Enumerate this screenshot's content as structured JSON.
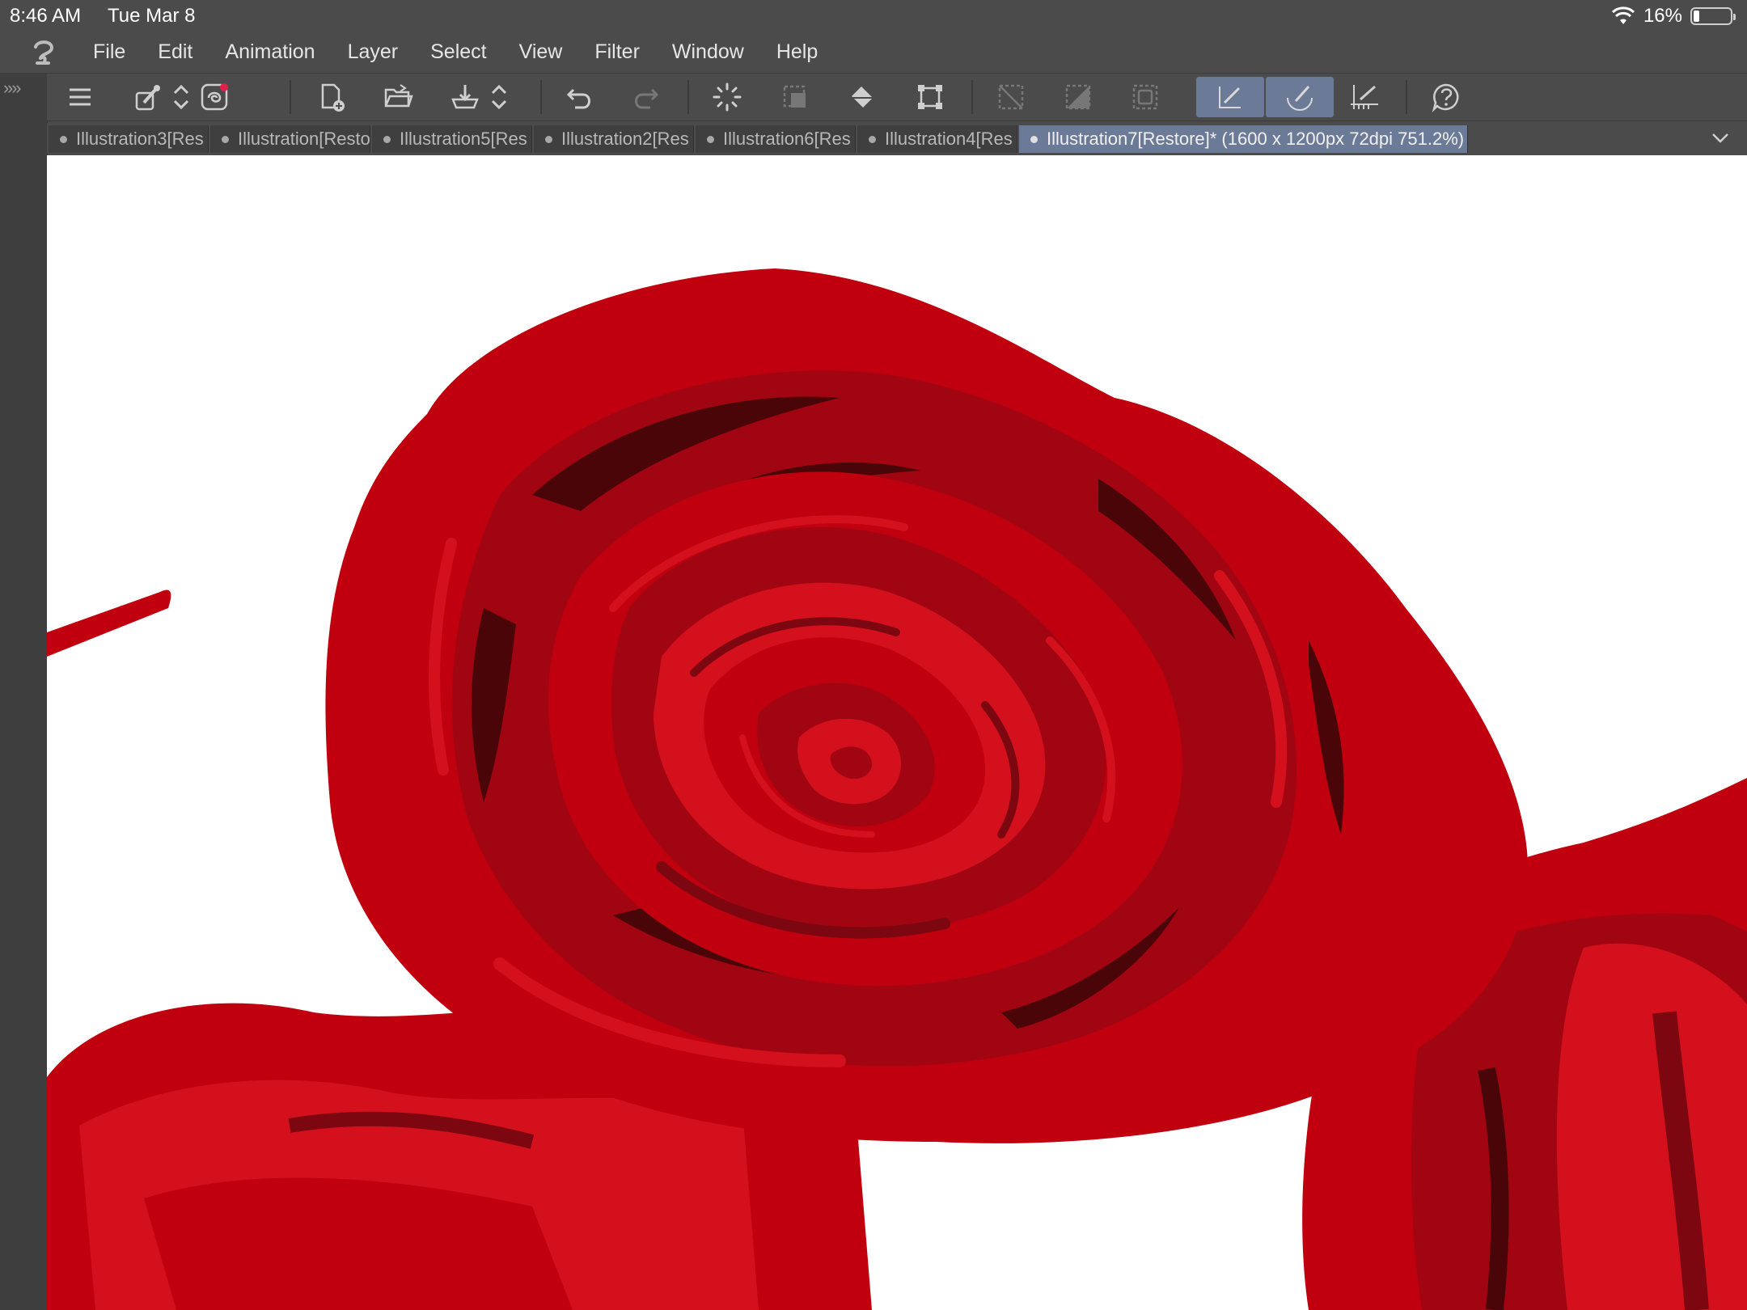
{
  "status_bar": {
    "time": "8:46 AM",
    "date": "Tue Mar 8",
    "battery_percent": "16%",
    "battery_level": 0.16
  },
  "menu": {
    "items": [
      "File",
      "Edit",
      "Animation",
      "Layer",
      "Select",
      "View",
      "Filter",
      "Window",
      "Help"
    ]
  },
  "toolbar": {
    "tools": [
      {
        "name": "menu-icon"
      },
      {
        "name": "eyedropper-icon"
      },
      {
        "name": "up-down-arrows-icon"
      },
      {
        "name": "companion-icon"
      },
      {
        "name": "new-document-icon"
      },
      {
        "name": "open-folder-icon"
      },
      {
        "name": "save-icon"
      },
      {
        "name": "up-down-arrows-icon"
      },
      {
        "name": "undo-icon"
      },
      {
        "name": "redo-icon"
      },
      {
        "name": "loading-spinner-icon"
      },
      {
        "name": "transform-selection-icon"
      },
      {
        "name": "fill-bucket-icon"
      },
      {
        "name": "transform-icon"
      },
      {
        "name": "clear-selection-icon"
      },
      {
        "name": "invert-selection-icon"
      },
      {
        "name": "show-selection-icon"
      },
      {
        "name": "snap-ruler-icon"
      },
      {
        "name": "snap-special-ruler-icon"
      },
      {
        "name": "snap-grid-icon"
      },
      {
        "name": "help-icon"
      }
    ]
  },
  "tabs": [
    {
      "label": "Illustration3[Res",
      "active": false
    },
    {
      "label": "Illustration[Resto",
      "active": false
    },
    {
      "label": "Illustration5[Res",
      "active": false
    },
    {
      "label": "Illustration2[Res",
      "active": false
    },
    {
      "label": "Illustration6[Res",
      "active": false
    },
    {
      "label": "Illustration4[Res",
      "active": false
    },
    {
      "label": "Illustration7[Restore]* (1600 x 1200px 72dpi 751.2%)",
      "active": true
    }
  ],
  "colors": {
    "rose_base": "#c0000f",
    "rose_mid": "#a10512",
    "rose_dark": "#4a0509",
    "rose_light": "#d4101d",
    "active_tab": "#6b7a96"
  }
}
